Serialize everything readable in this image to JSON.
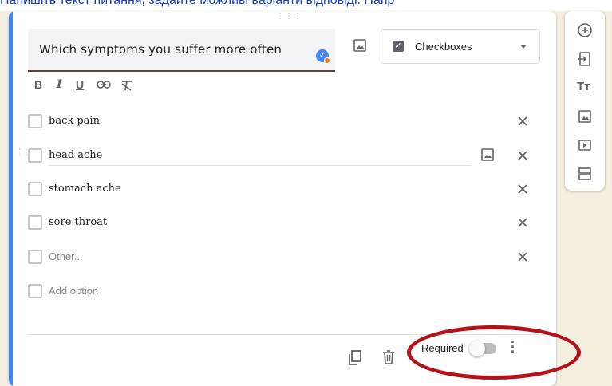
{
  "banner": {
    "text": "Напишіть текст питання, задайте можливі варіанти відповіді. Напр"
  },
  "question": {
    "text": "Which symptoms you suffer more often",
    "type_label": "Checkboxes"
  },
  "options": [
    {
      "label": "back pain",
      "style": "normal"
    },
    {
      "label": "head ache",
      "style": "normal"
    },
    {
      "label": "stomach ache",
      "style": "normal"
    },
    {
      "label": "sore throat",
      "style": "normal"
    },
    {
      "label": "Other...",
      "style": "muted"
    }
  ],
  "add_option": {
    "label": "Add option"
  },
  "footer": {
    "required_label": "Required",
    "required_on": false
  },
  "colors": {
    "accent": "#4285f4",
    "highlight_oval": "#b3121b",
    "banner_text": "#1a3cbf"
  },
  "icons": {
    "toolbar": [
      "add-question-icon",
      "import-questions-icon",
      "add-title-icon",
      "add-image-icon",
      "add-video-icon",
      "add-section-icon"
    ],
    "format": [
      "bold-icon",
      "italic-icon",
      "underline-icon",
      "link-icon",
      "clear-format-icon"
    ],
    "footer": [
      "duplicate-icon",
      "delete-icon",
      "more-options-icon"
    ]
  }
}
